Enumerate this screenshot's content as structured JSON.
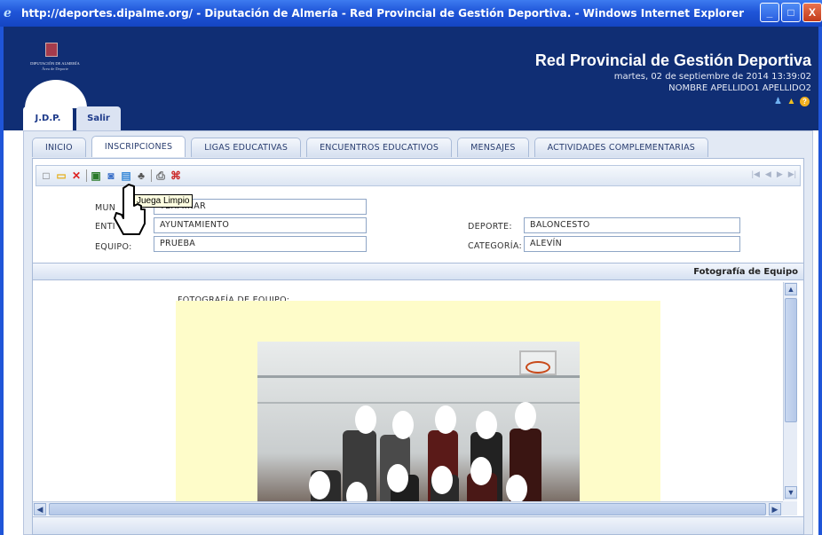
{
  "window": {
    "title": "http://deportes.dipalme.org/ - Diputación de Almería - Red Provincial de Gestión Deportiva. - Windows Internet Explorer",
    "minimize": "_",
    "maximize": "□",
    "close": "X"
  },
  "header": {
    "logo_line1": "DIPUTACIÓN DE ALMERÍA",
    "logo_line2": "Área de Deporte",
    "brand_title": "Red Provincial de Gestión Deportiva",
    "date": "martes, 02 de septiembre de 2014 13:39:02",
    "user": "NOMBRE APELLIDO1 APELLIDO2"
  },
  "top_tabs": [
    {
      "label": "J.D.P.",
      "active": true
    },
    {
      "label": "Salir",
      "active": false
    }
  ],
  "sub_tabs": [
    {
      "label": "INICIO",
      "active": false
    },
    {
      "label": "INSCRIPCIONES",
      "active": true
    },
    {
      "label": "LIGAS EDUCATIVAS",
      "active": false
    },
    {
      "label": "ENCUENTROS EDUCATIVOS",
      "active": false
    },
    {
      "label": "MENSAJES",
      "active": false
    },
    {
      "label": "ACTIVIDADES COMPLEMENTARIAS",
      "active": false
    }
  ],
  "toolbar": {
    "tooltip": "Juega Limpio",
    "nav": [
      "|◀",
      "◀",
      "▶",
      "▶|"
    ]
  },
  "form": {
    "municipio_label": "MUN",
    "municipio_value": "TERMINAR",
    "entidad_label": "ENTI",
    "entidad_value": "AYUNTAMIENTO",
    "equipo_label": "EQUIPO:",
    "equipo_value": "PRUEBA",
    "deporte_label": "DEPORTE:",
    "deporte_value": "BALONCESTO",
    "categoria_label": "CATEGORÍA:",
    "categoria_value": "ALEVÍN"
  },
  "section": {
    "title": "Fotografía de Equipo",
    "photo_label": "FOTOGRAFÍA DE EQUIPO:"
  },
  "colors": {
    "header_bg": "#102e74",
    "titlebar": "#1f55d8",
    "photo_bg": "#fefcc9"
  }
}
